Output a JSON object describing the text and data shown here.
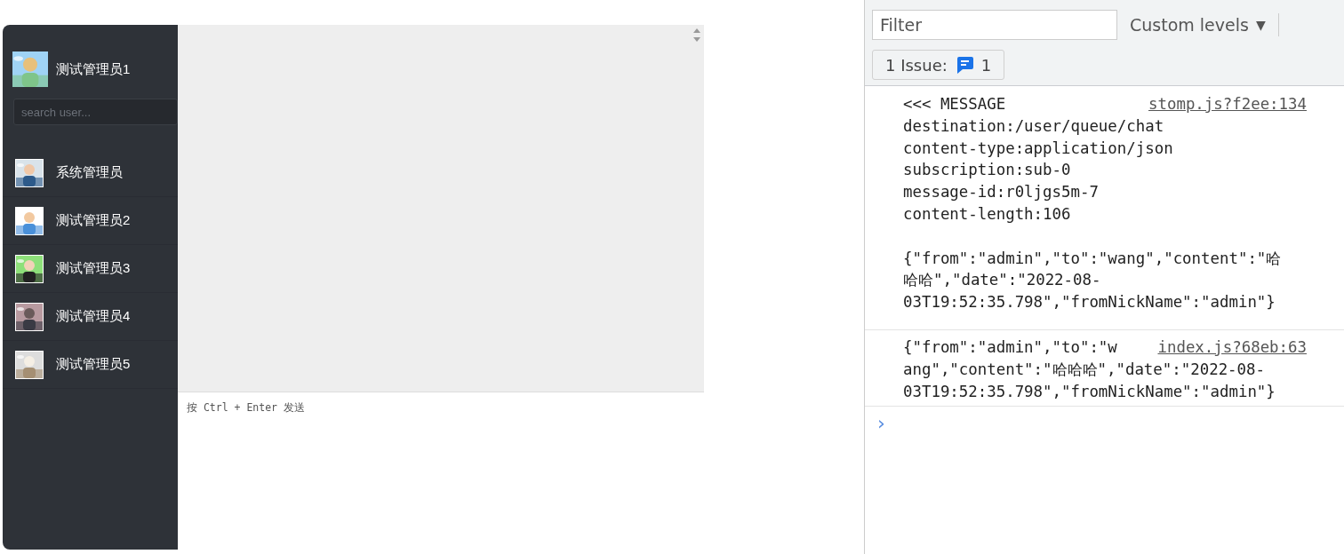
{
  "chat_app": {
    "current_user": {
      "name": "测试管理员1"
    },
    "search": {
      "placeholder": "search user..."
    },
    "users": [
      {
        "name": "系统管理员",
        "selected": false
      },
      {
        "name": "测试管理员2",
        "selected": false
      },
      {
        "name": "测试管理员3",
        "selected": false
      },
      {
        "name": "测试管理员4",
        "selected": false
      },
      {
        "name": "测试管理员5",
        "selected": false
      }
    ],
    "input_hint": "按 Ctrl + Enter 发送"
  },
  "devtools": {
    "filter": {
      "placeholder": "Filter"
    },
    "levels": "Custom levels",
    "levels_caret": "▼",
    "issues": {
      "label": "1 Issue:",
      "count": "1"
    },
    "messages": [
      {
        "blocks": [
          [
            "<<< MESSAGE",
            "destination:/user/queue/chat",
            "content-type:application/json",
            "subscription:sub-0",
            "message-id:r0ljgs5m-7",
            "content-length:106"
          ],
          [
            "{\"from\":\"admin\",\"to\":\"wang\",\"content\":\"哈",
            "哈哈\",\"date\":\"2022-08-",
            "03T19:52:35.798\",\"fromNickName\":\"admin\"}"
          ]
        ],
        "source": "stomp.js?f2ee:134"
      },
      {
        "blocks": [
          [
            "{\"from\":\"admin\",\"to\":\"w",
            "ang\",\"content\":\"哈哈哈\",\"date\":\"2022-08-",
            "03T19:52:35.798\",\"fromNickName\":\"admin\"}"
          ]
        ],
        "source": "index.js?68eb:63"
      }
    ],
    "prompt": "›"
  }
}
